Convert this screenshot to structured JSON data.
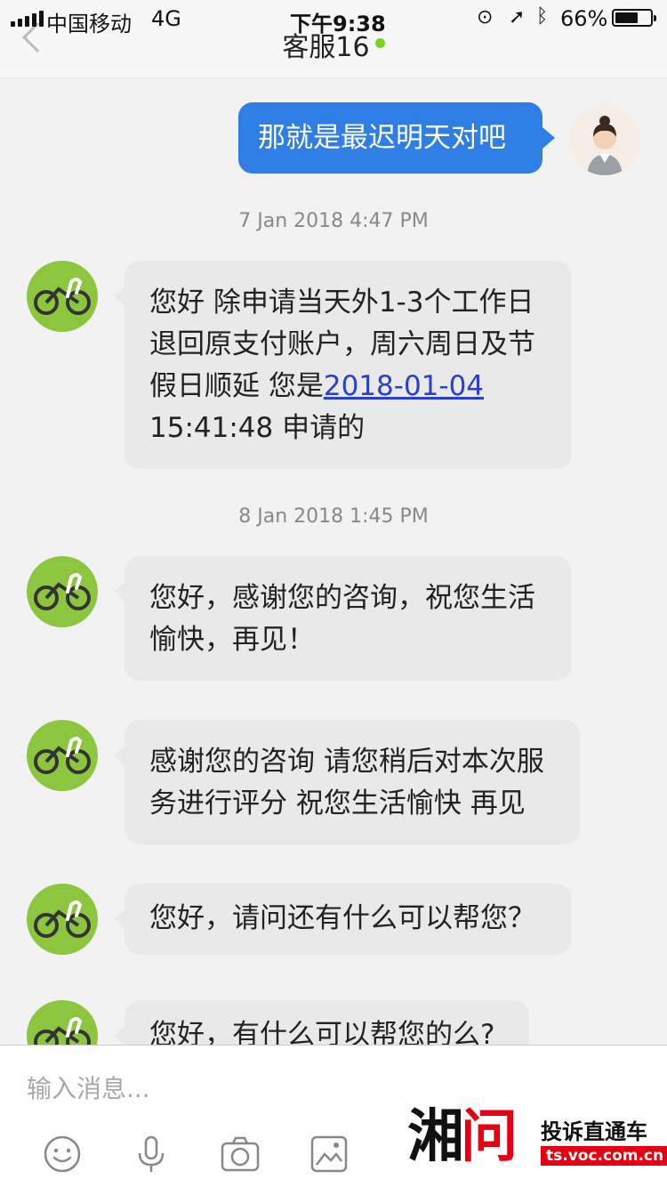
{
  "status_bar": {
    "carrier": "中国移动",
    "network": "4G",
    "time": "下午9:38",
    "battery_percent": "66%",
    "battery_level": 0.66
  },
  "header": {
    "title": "客服16",
    "online_color": "#7ed321"
  },
  "messages": {
    "m1": {
      "direction": "outgoing",
      "text": "那就是最迟明天对吧"
    },
    "ts1": "7 Jan 2018 4:47 PM",
    "m2": {
      "direction": "incoming",
      "line1": "您好 除申请当天外1-3个工作日",
      "line2": "退回原支付账户，周六周日及节",
      "line3_prefix": "假日顺延  您是",
      "line3_link": "2018-01-04",
      "line4": "15:41:48 申请的"
    },
    "ts2": "8 Jan 2018 1:45 PM",
    "m3": {
      "direction": "incoming",
      "line1": "您好，感谢您的咨询，祝您生活",
      "line2": "愉快，再见！"
    },
    "m4": {
      "direction": "incoming",
      "line1": "感谢您的咨询 请您稍后对本次服",
      "line2": "务进行评分 祝您生活愉快 再见"
    },
    "m5": {
      "direction": "incoming",
      "text": "您好，请问还有什么可以帮您？"
    },
    "m6": {
      "direction": "incoming",
      "text": "您好，有什么可以帮您的么?"
    }
  },
  "composer": {
    "placeholder": "输入消息...",
    "tools": [
      "emoji-icon",
      "microphone-icon",
      "camera-icon",
      "image-icon"
    ]
  },
  "watermark": {
    "logo_left": "湘",
    "logo_right": "问",
    "title": "投诉直通车",
    "url": "ts.voc.com.cn"
  },
  "colors": {
    "outgoing_bubble": "#2f7ee6",
    "incoming_bubble": "#e9e9e9",
    "bike_avatar": "#8cc63f",
    "link": "#2a3fd0",
    "watermark_red": "#e60012"
  }
}
